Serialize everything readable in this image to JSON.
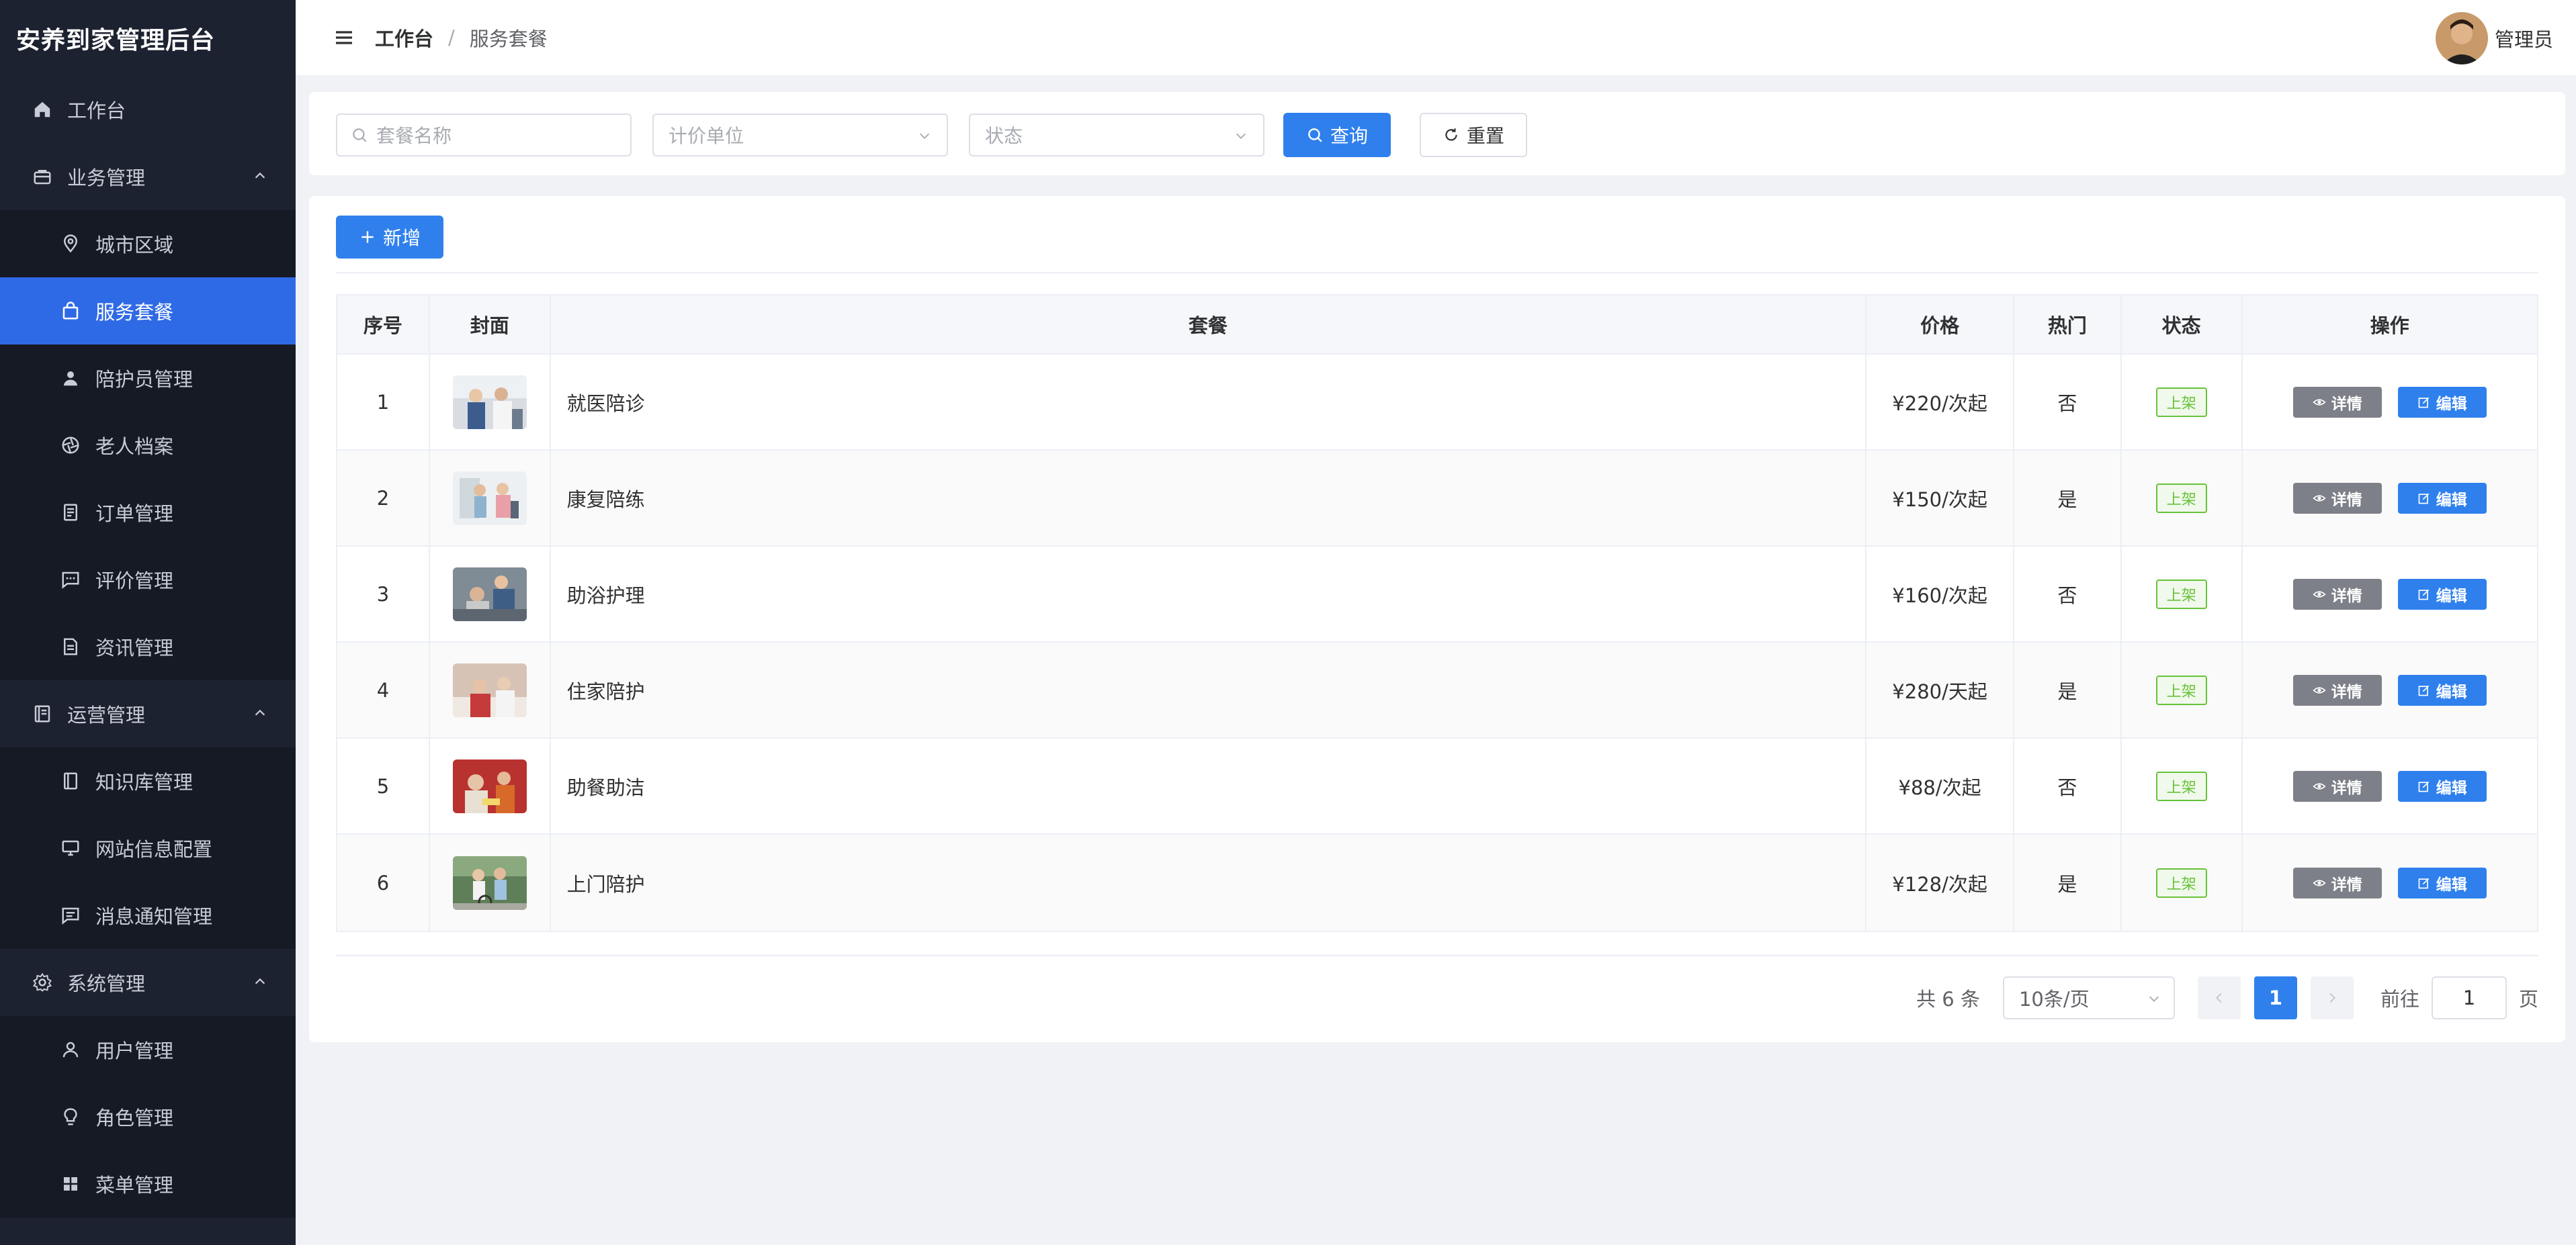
{
  "app": {
    "title": "安养到家管理后台"
  },
  "sidebar": {
    "items": [
      {
        "label": "工作台",
        "icon": "home-icon",
        "level": "top"
      },
      {
        "label": "业务管理",
        "icon": "briefcase-icon",
        "level": "group"
      },
      {
        "label": "城市区域",
        "icon": "location-pin-icon",
        "level": "sub"
      },
      {
        "label": "服务套餐",
        "icon": "shopping-bag-icon",
        "level": "sub",
        "active": true
      },
      {
        "label": "陪护员管理",
        "icon": "user-icon",
        "level": "sub"
      },
      {
        "label": "老人档案",
        "icon": "aperture-icon",
        "level": "sub"
      },
      {
        "label": "订单管理",
        "icon": "document-list-icon",
        "level": "sub"
      },
      {
        "label": "评价管理",
        "icon": "chat-bubble-icon",
        "level": "sub"
      },
      {
        "label": "资讯管理",
        "icon": "document-icon",
        "level": "sub"
      },
      {
        "label": "运营管理",
        "icon": "notebook-icon",
        "level": "group"
      },
      {
        "label": "知识库管理",
        "icon": "book-icon",
        "level": "sub"
      },
      {
        "label": "网站信息配置",
        "icon": "monitor-icon",
        "level": "sub"
      },
      {
        "label": "消息通知管理",
        "icon": "message-icon",
        "level": "sub"
      },
      {
        "label": "系统管理",
        "icon": "gear-icon",
        "level": "group"
      },
      {
        "label": "用户管理",
        "icon": "user-outline-icon",
        "level": "sub"
      },
      {
        "label": "角色管理",
        "icon": "lightbulb-icon",
        "level": "sub"
      },
      {
        "label": "菜单管理",
        "icon": "grid-icon",
        "level": "sub"
      }
    ]
  },
  "header": {
    "breadcrumb_home": "工作台",
    "breadcrumb_sep": "/",
    "breadcrumb_current": "服务套餐",
    "user_name": "管理员"
  },
  "search": {
    "name_placeholder": "套餐名称",
    "unit_placeholder": "计价单位",
    "status_placeholder": "状态",
    "query_label": "查询",
    "reset_label": "重置"
  },
  "toolbar": {
    "add_label": "新增"
  },
  "table": {
    "columns": [
      "序号",
      "封面",
      "套餐",
      "价格",
      "热门",
      "状态",
      "操作"
    ],
    "detail_label": "详情",
    "edit_label": "编辑",
    "rows": [
      {
        "no": "1",
        "name": "就医陪诊",
        "price": "¥220/次起",
        "hot": "否",
        "status": "上架"
      },
      {
        "no": "2",
        "name": "康复陪练",
        "price": "¥150/次起",
        "hot": "是",
        "status": "上架"
      },
      {
        "no": "3",
        "name": "助浴护理",
        "price": "¥160/次起",
        "hot": "否",
        "status": "上架"
      },
      {
        "no": "4",
        "name": "住家陪护",
        "price": "¥280/天起",
        "hot": "是",
        "status": "上架"
      },
      {
        "no": "5",
        "name": "助餐助洁",
        "price": "¥88/次起",
        "hot": "否",
        "status": "上架"
      },
      {
        "no": "6",
        "name": "上门陪护",
        "price": "¥128/次起",
        "hot": "是",
        "status": "上架"
      }
    ]
  },
  "pagination": {
    "total": "共 6 条",
    "page_size": "10条/页",
    "current_page": "1",
    "goto_label": "前往",
    "goto_value": "1",
    "page_suffix": "页"
  },
  "colors": {
    "sidebar_bg": "#1d2230",
    "accent": "#2f80ed",
    "active_menu": "#2f6ae6",
    "tag_green": "#67c23a"
  }
}
